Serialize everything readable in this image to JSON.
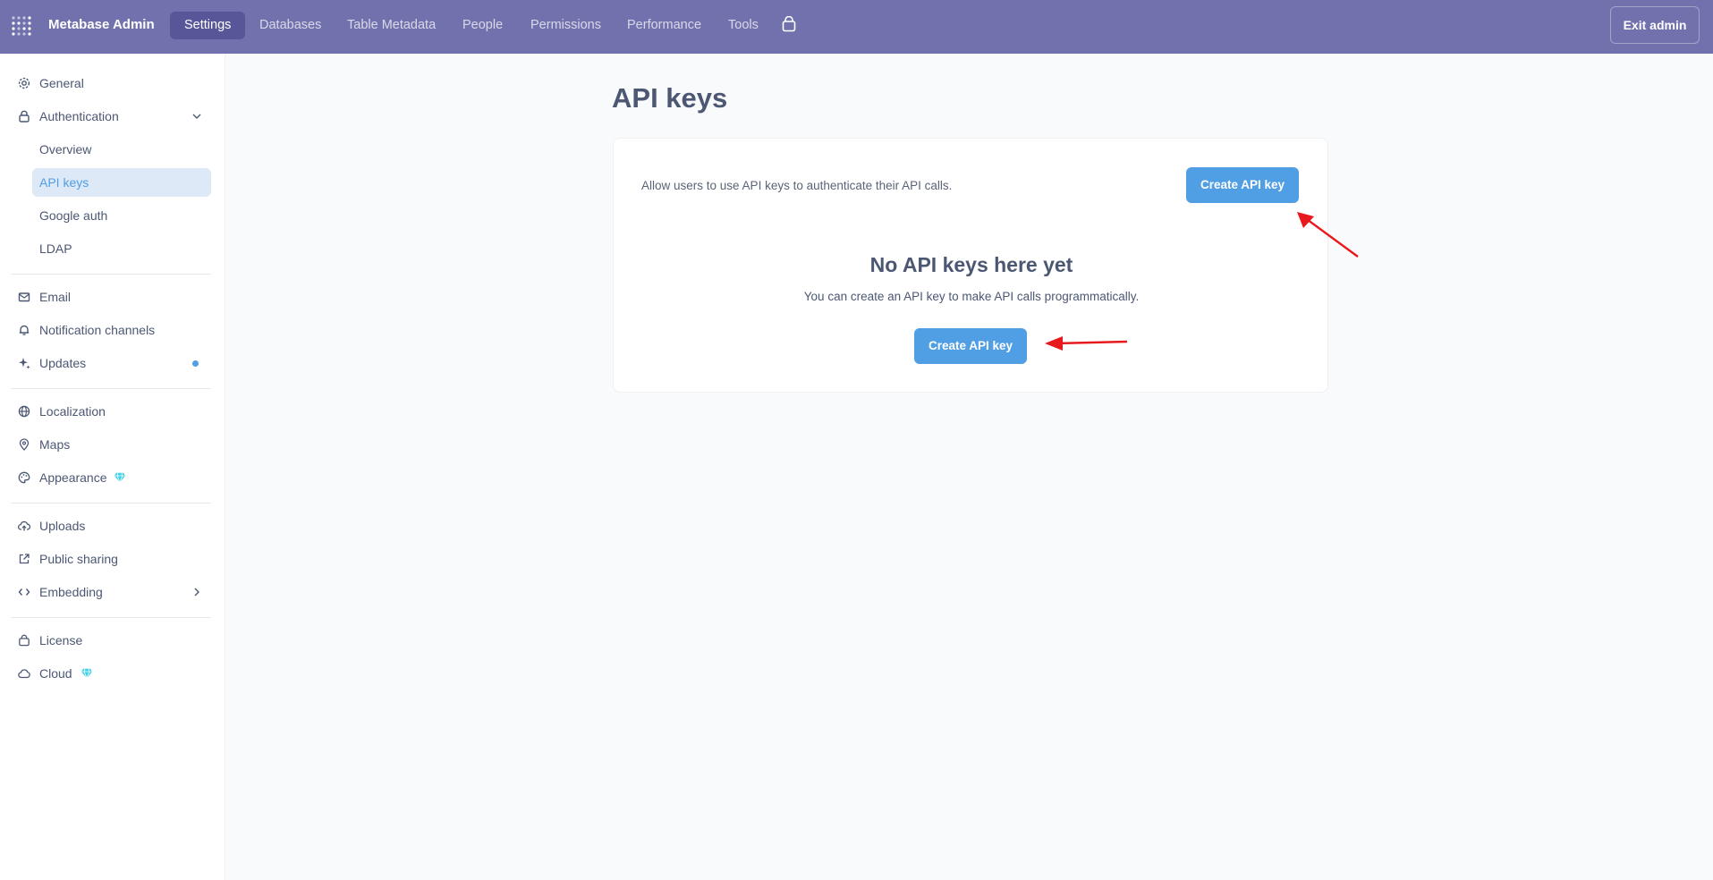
{
  "header": {
    "brand": "Metabase Admin",
    "tabs": [
      {
        "label": "Settings",
        "active": true
      },
      {
        "label": "Databases"
      },
      {
        "label": "Table Metadata"
      },
      {
        "label": "People"
      },
      {
        "label": "Permissions"
      },
      {
        "label": "Performance"
      },
      {
        "label": "Tools"
      }
    ],
    "exit_label": "Exit admin"
  },
  "sidebar": {
    "items": {
      "general": "General",
      "authentication": "Authentication",
      "overview": "Overview",
      "api_keys": "API keys",
      "google_auth": "Google auth",
      "ldap": "LDAP",
      "email": "Email",
      "notification_channels": "Notification channels",
      "updates": "Updates",
      "localization": "Localization",
      "maps": "Maps",
      "appearance": "Appearance",
      "uploads": "Uploads",
      "public_sharing": "Public sharing",
      "embedding": "Embedding",
      "license": "License",
      "cloud": "Cloud"
    },
    "active": "API keys"
  },
  "main": {
    "title": "API keys",
    "description": "Allow users to use API keys to authenticate their API calls.",
    "create_button": "Create API key",
    "empty_title": "No API keys here yet",
    "empty_subtitle": "You can create an API key to make API calls programmatically.",
    "empty_create_button": "Create API key"
  },
  "colors": {
    "header_bg": "#7172ad",
    "brand_blue": "#509ee3",
    "annotation_arrow": "#e8191c",
    "gem": "#3fd0e6"
  }
}
